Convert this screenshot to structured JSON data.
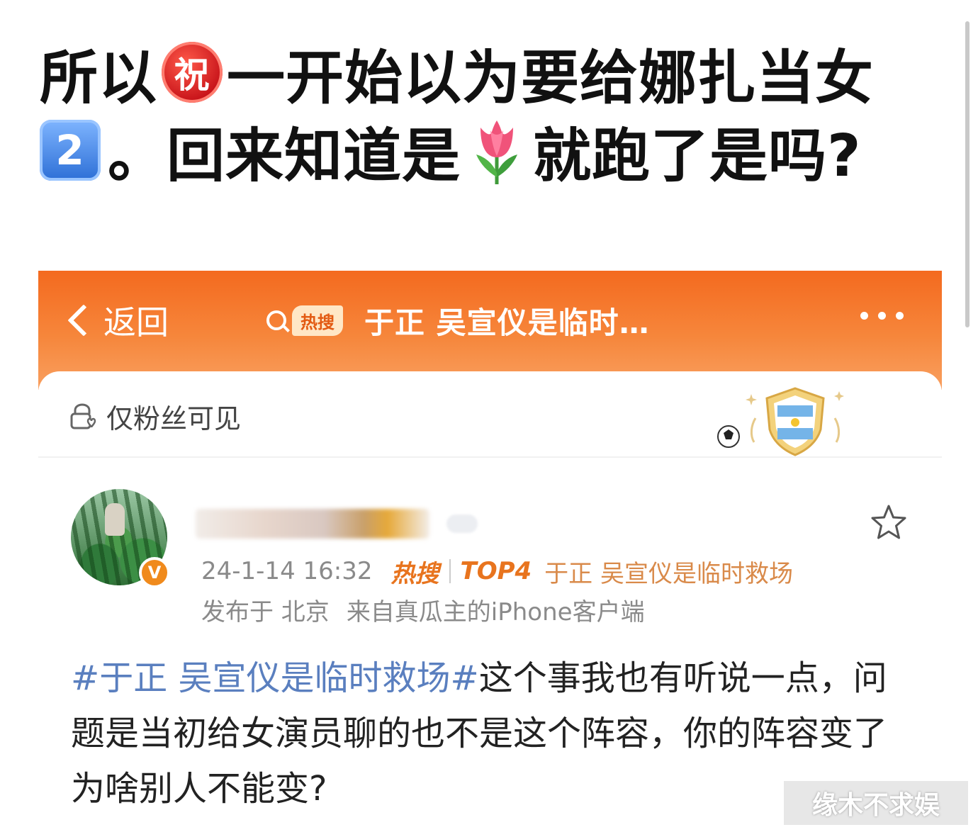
{
  "caption": {
    "line1_prefix": "所以",
    "emoji_zhu": "祝",
    "line1_rest": "一开始以为要给娜扎当女",
    "emoji_two": "2",
    "line2_a": "。回来知道是",
    "line2_b": "就跑了是吗?"
  },
  "topbar": {
    "back_label": "返回",
    "hot_tag": "热搜",
    "title": "于正 吴宣仪是临时…"
  },
  "visibility": {
    "label": "仅粉丝可见"
  },
  "post": {
    "verified_mark": "V",
    "timestamp": "24-1-14 16:32",
    "hot_label": "热搜",
    "rank": "TOP4",
    "hot_topic": "于正 吴宣仪是临时救场",
    "location": "发布于 北京",
    "source": "来自真瓜主的iPhone客户端",
    "hashtag": "#于正 吴宣仪是临时救场#",
    "body": "这个事我也有听说一点，问题是当初给女演员聊的也不是这个阵容，你的阵容变了为啥别人不能变?"
  },
  "watermark": "缘木不求娱",
  "colors": {
    "topbar": "#f46a1f",
    "hot_orange": "#e8741e",
    "hashtag_blue": "#5a7fbf"
  }
}
